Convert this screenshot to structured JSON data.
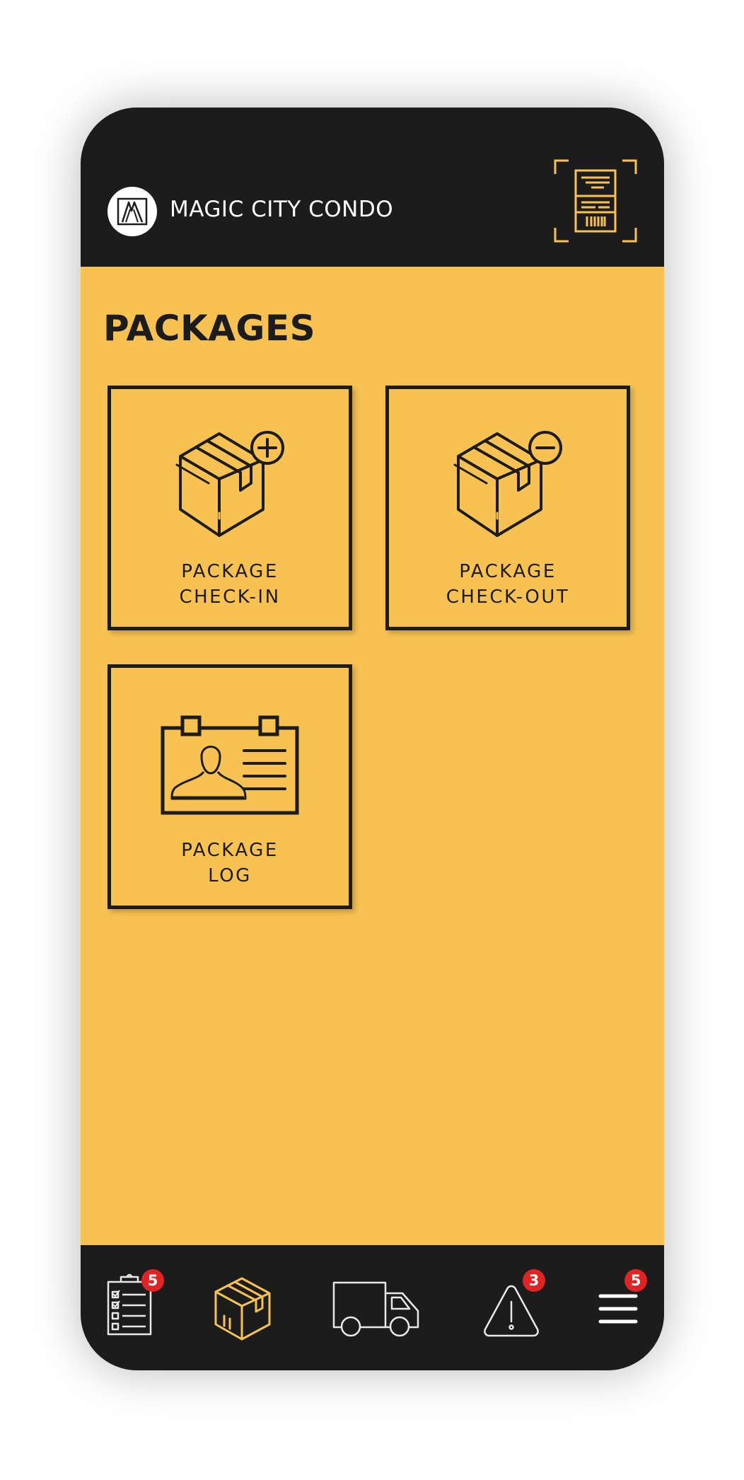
{
  "header": {
    "brand": "MAGIC CITY CONDO",
    "logo_icon": "building-logo-icon",
    "scan_icon": "barcode-scan-icon"
  },
  "page": {
    "title": "PACKAGES"
  },
  "tiles": [
    {
      "label_line1": "PACKAGE",
      "label_line2": "CHECK-IN",
      "icon": "package-add-icon"
    },
    {
      "label_line1": "PACKAGE",
      "label_line2": "CHECK-OUT",
      "icon": "package-remove-icon"
    },
    {
      "label_line1": "PACKAGE",
      "label_line2": "LOG",
      "icon": "id-card-icon"
    }
  ],
  "nav": {
    "tasks_badge": "5",
    "alerts_badge": "3",
    "menu_badge": "5"
  },
  "colors": {
    "accent": "#f8c253",
    "dark": "#1c1c1c",
    "badge": "#e02424"
  }
}
